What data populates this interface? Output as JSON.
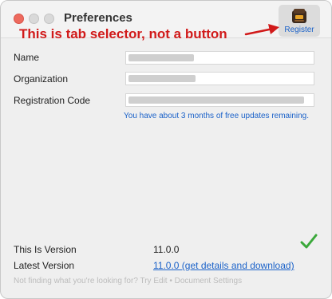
{
  "window": {
    "title": "Preferences",
    "annotation": "This is tab selector, not a button",
    "tab": {
      "label": "Register",
      "icon": "register-app-icon"
    }
  },
  "form": {
    "name": {
      "label": "Name",
      "value": ""
    },
    "organization": {
      "label": "Organization",
      "value": ""
    },
    "registration_code": {
      "label": "Registration Code",
      "value": ""
    },
    "note": "You have about 3 months of free updates remaining."
  },
  "version": {
    "this_label": "This Is Version",
    "this_value": "11.0.0",
    "latest_label": "Latest Version",
    "latest_link": "11.0.0 (get details and download)",
    "status_icon": "checkmark-icon"
  },
  "footer": "Not finding what you're looking for? Try Edit • Document Settings",
  "colors": {
    "annotation": "#d11a1a",
    "link": "#1b62c9",
    "check": "#3aa83a",
    "close": "#ed6a5e"
  }
}
